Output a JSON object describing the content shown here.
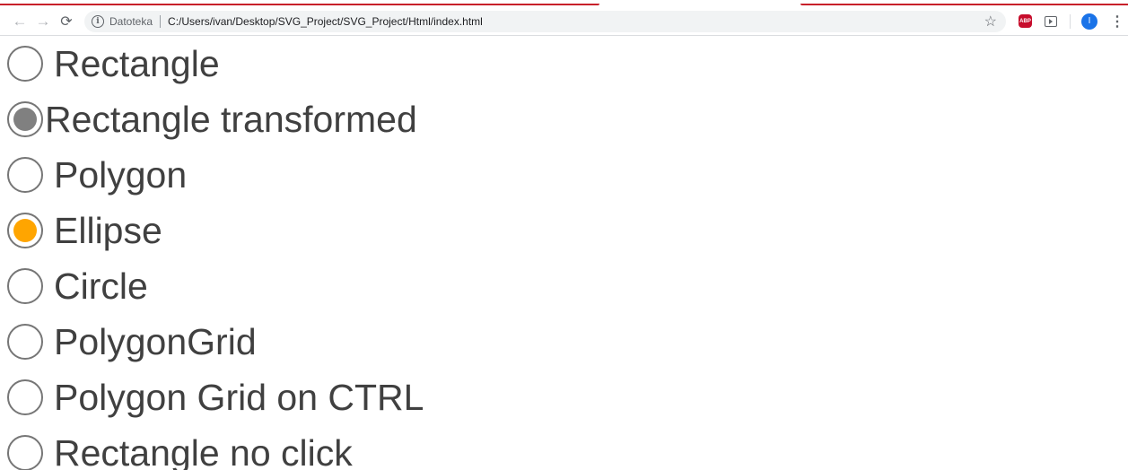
{
  "browser": {
    "scheme_label": "Datoteka",
    "url": "C:/Users/ivan/Desktop/SVG_Project/SVG_Project/Html/index.html",
    "avatar_letter": "I",
    "abp_label": "ABP",
    "accent_color": "#c8202a"
  },
  "options": [
    {
      "label": "Rectangle",
      "checked": false,
      "dot_color": ""
    },
    {
      "label": "Rectangle transformed",
      "checked": true,
      "dot_color": "#808080"
    },
    {
      "label": "Polygon",
      "checked": false,
      "dot_color": ""
    },
    {
      "label": "Ellipse",
      "checked": true,
      "dot_color": "#ffa500"
    },
    {
      "label": "Circle",
      "checked": false,
      "dot_color": ""
    },
    {
      "label": "PolygonGrid",
      "checked": false,
      "dot_color": ""
    },
    {
      "label": "Polygon Grid on CTRL",
      "checked": false,
      "dot_color": ""
    },
    {
      "label": "Rectangle no click",
      "checked": false,
      "dot_color": ""
    }
  ]
}
